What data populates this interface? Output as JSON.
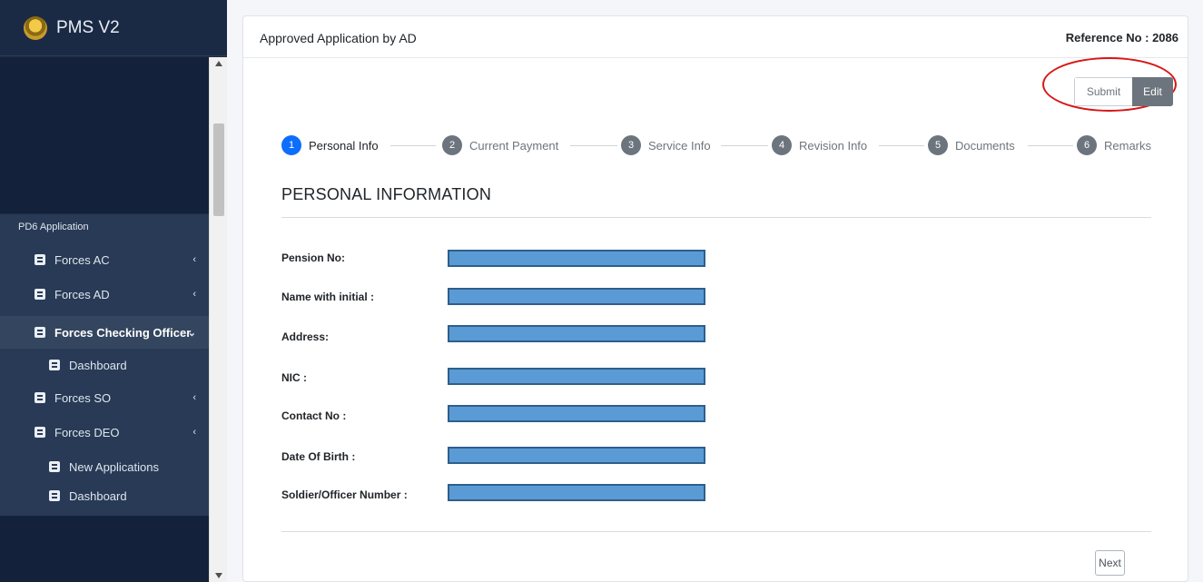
{
  "app": {
    "name": "PMS V2"
  },
  "sidebar": {
    "section_header": "PD6 Application",
    "items": [
      {
        "label": "Forces AC",
        "chevron": "‹"
      },
      {
        "label": "Forces AD",
        "chevron": "‹"
      },
      {
        "label": "Forces Checking Officer",
        "chevron": "⌄"
      },
      {
        "label": "Dashboard"
      },
      {
        "label": "Forces SO",
        "chevron": "‹"
      },
      {
        "label": "Forces DEO",
        "chevron": "‹"
      },
      {
        "label": "New Applications"
      },
      {
        "label": "Dashboard"
      }
    ]
  },
  "card": {
    "title": "Approved Application by AD",
    "reference": "Reference No : 2086",
    "submit_label": "Submit",
    "edit_label": "Edit"
  },
  "steps": [
    {
      "num": "1",
      "label": "Personal Info"
    },
    {
      "num": "2",
      "label": "Current Payment"
    },
    {
      "num": "3",
      "label": "Service Info"
    },
    {
      "num": "4",
      "label": "Revision Info"
    },
    {
      "num": "5",
      "label": "Documents"
    },
    {
      "num": "6",
      "label": "Remarks"
    }
  ],
  "section": {
    "title": "PERSONAL INFORMATION"
  },
  "fields": [
    {
      "label": "Pension No:"
    },
    {
      "label": "Name with initial :"
    },
    {
      "label": "Address:"
    },
    {
      "label": "NIC :"
    },
    {
      "label": "Contact No :"
    },
    {
      "label": "Date Of Birth :"
    },
    {
      "label": "Soldier/Officer Number :"
    }
  ],
  "next_label": "Next",
  "colors": {
    "active_step": "#0d6efd",
    "sidebar": "#1c2b45",
    "highlight": "#d81616",
    "redaction": "#5b9bd5"
  }
}
